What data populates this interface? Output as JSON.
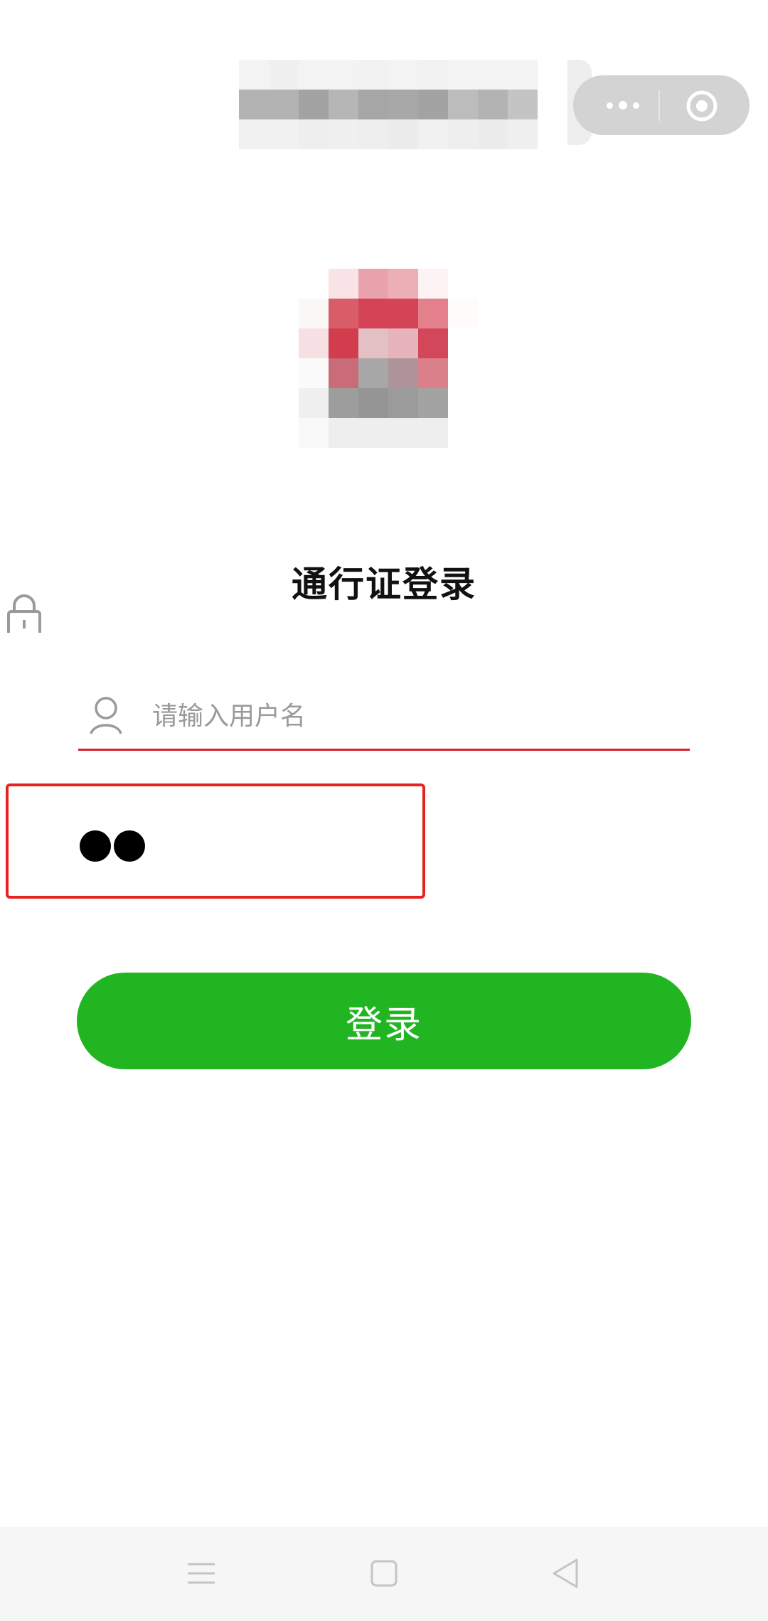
{
  "header": {
    "title_mosaic": [
      [
        "#f3f3f3",
        "#f0f0f0",
        "#f3f3f3",
        "#f3f3f3",
        "#f2f2f2",
        "#f3f3f3",
        "#f2f2f2",
        "#f3f3f3",
        "#f3f3f3",
        "#f3f3f3"
      ],
      [
        "#b3b3b3",
        "#b3b3b3",
        "#a3a3a3",
        "#b6b6b6",
        "#a6a6a6",
        "#a8a8a8",
        "#a3a3a3",
        "#bcbcbc",
        "#b3b3b3",
        "#c4c4c4"
      ],
      [
        "#f1f1f1",
        "#f1f1f1",
        "#eeeeee",
        "#f0f0f0",
        "#eeeeee",
        "#ececec",
        "#f1f1f1",
        "#eeeeee",
        "#ececec",
        "#f0f0f0"
      ]
    ],
    "capsule": {
      "more_icon": "more-dots-icon",
      "close_icon": "target-circle-icon"
    }
  },
  "logo": {
    "mosaic": [
      [
        "#ffffff",
        "#f8e3e7",
        "#eaa3ac",
        "#ecafb6",
        "#fdf2f4",
        "#ffffff"
      ],
      [
        "#fbf7f7",
        "#d95c69",
        "#d54456",
        "#d44457",
        "#e4808b",
        "#fffbfb"
      ],
      [
        "#f7e0e3",
        "#d23d4e",
        "#e2c0c3",
        "#e8b4bb",
        "#d3475a",
        "#ffffff"
      ],
      [
        "#fbfbfb",
        "#c96b78",
        "#a7a7a7",
        "#ae9499",
        "#da808b",
        "#ffffff"
      ],
      [
        "#f0f0f0",
        "#9d9d9d",
        "#959595",
        "#9b9b9b",
        "#a3a3a3",
        "#ffffff"
      ],
      [
        "#f9f9f9",
        "#eeeeee",
        "#eeeeee",
        "#eeeeee",
        "#eeeeee",
        "#ffffff"
      ]
    ]
  },
  "login": {
    "heading": "通行证登录",
    "username_placeholder": "请输入用户名",
    "username_value": "",
    "password_dots": 2,
    "submit_label": "登录"
  },
  "colors": {
    "accent_red": "#d6222a",
    "highlight_red": "#e8231f",
    "button_green": "#21b521"
  },
  "navbar": {
    "items": [
      "menu-icon",
      "home-square-icon",
      "back-triangle-icon"
    ]
  }
}
